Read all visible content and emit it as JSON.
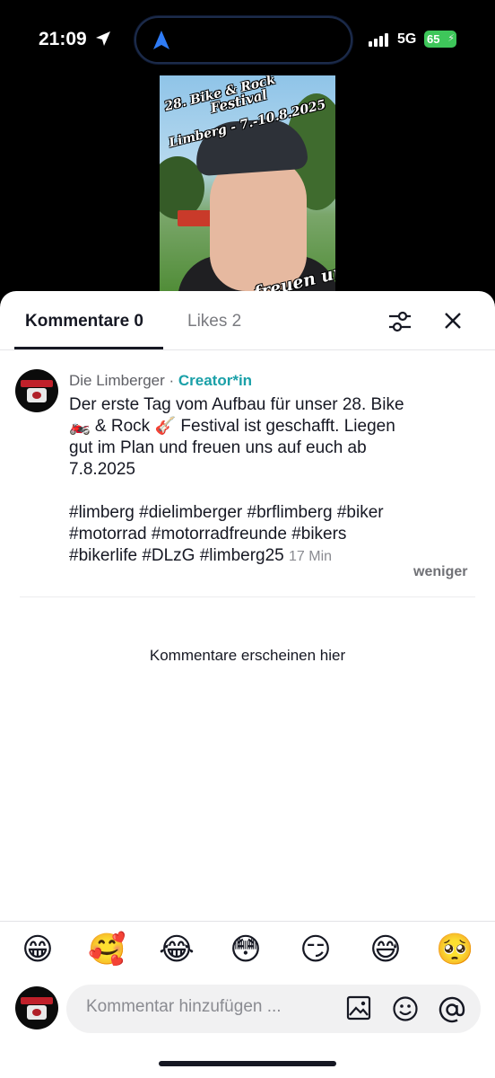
{
  "status_bar": {
    "time": "21:09",
    "network": "5G",
    "battery": "65"
  },
  "video": {
    "overlay_line1": "28. Bike & Rock",
    "overlay_line2": "Festival",
    "overlay_line3": "Limberg - 7.-10.8.2025",
    "overlay_bottom": "freuen uns"
  },
  "tabs": {
    "comments": "Kommentare 0",
    "likes": "Likes 2"
  },
  "post": {
    "author": "Die Limberger",
    "separator": " · ",
    "badge": "Creator*in",
    "line1": "Der erste Tag vom Aufbau für unser 28. Bike",
    "line2": "🏍️ & Rock 🎸 Festival ist geschafft. Liegen",
    "line3": "gut im Plan und freuen uns auf euch ab",
    "line4": "7.8.2025",
    "tags1": "#limberg #dielimberger #brflimberg #biker",
    "tags2": "#motorrad #motorradfreunde #bikers",
    "tags3": "#bikerlife #DLzG #limberg25",
    "time_ago": "17 Min",
    "less": "weniger"
  },
  "empty_state": "Kommentare erscheinen hier",
  "emojis": [
    "😁",
    "🥰",
    "😂",
    "😳",
    "😏",
    "😅",
    "🥺"
  ],
  "input": {
    "placeholder": "Kommentar hinzufügen ..."
  },
  "icons": [
    "location-arrow-icon",
    "navigation-icon",
    "filter-icon",
    "close-icon",
    "image-icon",
    "emoji-icon",
    "mention-icon"
  ]
}
